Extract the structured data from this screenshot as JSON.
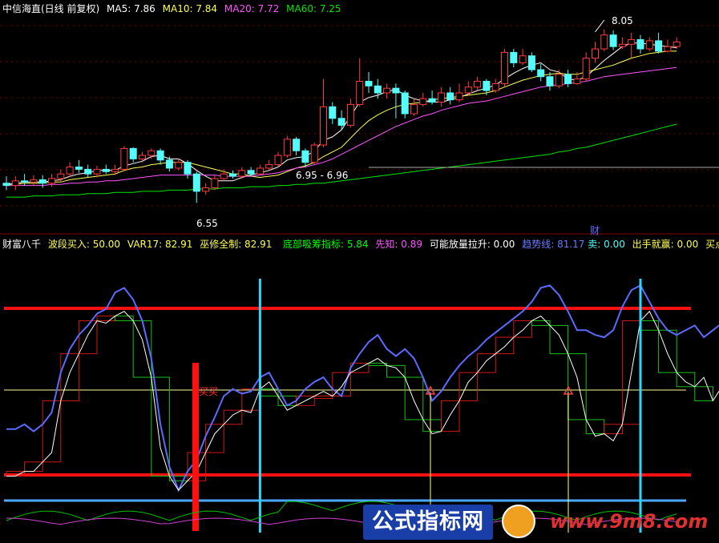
{
  "upper_header": {
    "title": "中信海直(日线 前复权)",
    "ma5": "MA5: 7.86",
    "ma10": "MA10: 7.84",
    "ma20": "MA20: 7.72",
    "ma60": "MA60: 7.25"
  },
  "lower_header": {
    "name": "财富八千",
    "bd": "波段买入: 50.00",
    "var17": "VAR17: 82.91",
    "wx": "巫修全制: 82.91",
    "dbxc": "底部吸筹指标: 5.84",
    "xz": "先知: 0.89",
    "knflls": "可能放量拉升: 0.00",
    "qsx": "趋势线: 81.17",
    "mai": "卖: 0.00",
    "cs": "出手就赢: 0.00",
    "mdzb": "买点准备:"
  },
  "annotations": {
    "high": "8.05",
    "low": "6.55",
    "range": "6.95 - 6.96",
    "cai": "财",
    "buy": "买买"
  },
  "watermark": {
    "text": "公式指标网",
    "url": "www.9m8.com"
  },
  "colors": {
    "up": "#ff3c3c",
    "down": "#54fcfc",
    "ma5": "#ffffff",
    "ma10": "#ffff54",
    "ma20": "#ff54ff",
    "ma60": "#00e600",
    "lower_line1": "#5b6bff",
    "lower_line2": "#ffffff",
    "cyan": "#28d8ff",
    "red": "#ff1010"
  },
  "chart_data": [
    {
      "type": "candlestick",
      "title": "中信海直(日线 前复权)",
      "ylim": [
        6.4,
        8.15
      ],
      "series": [
        {
          "name": "K",
          "values": [
            [
              6.72,
              6.7,
              6.78,
              6.66
            ],
            [
              6.7,
              6.74,
              6.78,
              6.66
            ],
            [
              6.74,
              6.73,
              6.8,
              6.7
            ],
            [
              6.73,
              6.75,
              6.79,
              6.7
            ],
            [
              6.75,
              6.72,
              6.79,
              6.68
            ],
            [
              6.72,
              6.76,
              6.8,
              6.69
            ],
            [
              6.76,
              6.8,
              6.84,
              6.73
            ],
            [
              6.8,
              6.86,
              6.9,
              6.77
            ],
            [
              6.86,
              6.84,
              6.92,
              6.81
            ],
            [
              6.84,
              6.8,
              6.88,
              6.77
            ],
            [
              6.8,
              6.84,
              6.87,
              6.77
            ],
            [
              6.84,
              6.82,
              6.88,
              6.8
            ],
            [
              6.82,
              6.84,
              6.88,
              6.79
            ],
            [
              6.84,
              7.02,
              7.04,
              6.82
            ],
            [
              7.02,
              6.93,
              7.03,
              6.9
            ],
            [
              6.93,
              6.96,
              6.99,
              6.9
            ],
            [
              6.96,
              7.0,
              7.02,
              6.93
            ],
            [
              7.0,
              6.92,
              7.02,
              6.88
            ],
            [
              6.92,
              6.85,
              6.95,
              6.82
            ],
            [
              6.85,
              6.9,
              6.93,
              6.83
            ],
            [
              6.9,
              6.8,
              6.92,
              6.76
            ],
            [
              6.8,
              6.65,
              6.82,
              6.55
            ],
            [
              6.65,
              6.68,
              6.72,
              6.62
            ],
            [
              6.68,
              6.76,
              6.79,
              6.66
            ],
            [
              6.76,
              6.8,
              6.84,
              6.74
            ],
            [
              6.8,
              6.78,
              6.83,
              6.76
            ],
            [
              6.78,
              6.83,
              6.86,
              6.76
            ],
            [
              6.83,
              6.8,
              6.86,
              6.78
            ],
            [
              6.8,
              6.85,
              6.88,
              6.79
            ],
            [
              6.85,
              6.88,
              6.92,
              6.83
            ],
            [
              6.88,
              6.96,
              6.99,
              6.86
            ],
            [
              6.96,
              7.1,
              7.13,
              6.94
            ],
            [
              7.1,
              7.0,
              7.12,
              6.96
            ],
            [
              7.0,
              6.9,
              7.02,
              6.86
            ],
            [
              6.9,
              7.05,
              7.07,
              6.88
            ],
            [
              7.05,
              7.38,
              7.62,
              7.03
            ],
            [
              7.38,
              7.28,
              7.42,
              7.23
            ],
            [
              7.28,
              7.22,
              7.35,
              7.18
            ],
            [
              7.22,
              7.4,
              7.45,
              7.2
            ],
            [
              7.4,
              7.6,
              7.8,
              7.38
            ],
            [
              7.6,
              7.56,
              7.68,
              7.5
            ],
            [
              7.56,
              7.5,
              7.62,
              7.45
            ],
            [
              7.5,
              7.54,
              7.58,
              7.45
            ],
            [
              7.54,
              7.5,
              7.58,
              7.28
            ],
            [
              7.5,
              7.32,
              7.52,
              7.28
            ],
            [
              7.32,
              7.4,
              7.45,
              7.3
            ],
            [
              7.4,
              7.45,
              7.5,
              7.38
            ],
            [
              7.45,
              7.42,
              7.52,
              7.4
            ],
            [
              7.42,
              7.5,
              7.55,
              7.38
            ],
            [
              7.5,
              7.44,
              7.55,
              7.4
            ],
            [
              7.44,
              7.5,
              7.58,
              7.42
            ],
            [
              7.5,
              7.55,
              7.6,
              7.48
            ],
            [
              7.55,
              7.6,
              7.64,
              7.52
            ],
            [
              7.6,
              7.52,
              7.62,
              7.48
            ],
            [
              7.52,
              7.58,
              7.62,
              7.5
            ],
            [
              7.58,
              7.85,
              7.88,
              7.55
            ],
            [
              7.85,
              7.76,
              7.88,
              7.72
            ],
            [
              7.76,
              7.82,
              7.88,
              7.74
            ],
            [
              7.82,
              7.7,
              7.85,
              7.68
            ],
            [
              7.7,
              7.64,
              7.75,
              7.6
            ],
            [
              7.64,
              7.56,
              7.68,
              7.52
            ],
            [
              7.56,
              7.66,
              7.7,
              7.54
            ],
            [
              7.66,
              7.58,
              7.7,
              7.55
            ],
            [
              7.58,
              7.62,
              7.68,
              7.57
            ],
            [
              7.62,
              7.8,
              7.85,
              7.6
            ],
            [
              7.8,
              7.88,
              7.94,
              7.76
            ],
            [
              7.88,
              8.0,
              8.05,
              7.86
            ],
            [
              8.0,
              7.9,
              8.04,
              7.87
            ],
            [
              7.9,
              7.92,
              7.98,
              7.88
            ],
            [
              7.92,
              7.96,
              8.02,
              7.8
            ],
            [
              7.96,
              7.88,
              8.0,
              7.84
            ],
            [
              7.88,
              7.95,
              7.98,
              7.86
            ],
            [
              7.95,
              7.86,
              8.02,
              7.84
            ],
            [
              7.86,
              7.9,
              7.96,
              7.85
            ],
            [
              7.9,
              7.94,
              7.98,
              7.88
            ]
          ]
        },
        {
          "name": "MA5",
          "values": [
            6.71,
            6.72,
            6.73,
            6.73,
            6.73,
            6.74,
            6.75,
            6.78,
            6.8,
            6.81,
            6.83,
            6.83,
            6.83,
            6.87,
            6.89,
            6.91,
            6.95,
            6.96,
            6.93,
            6.93,
            6.89,
            6.83,
            6.78,
            6.74,
            6.74,
            6.74,
            6.77,
            6.79,
            6.81,
            6.83,
            6.86,
            6.92,
            6.94,
            6.95,
            7.0,
            7.09,
            7.12,
            7.18,
            7.3,
            7.42,
            7.46,
            7.48,
            7.51,
            7.53,
            7.48,
            7.45,
            7.43,
            7.42,
            7.42,
            7.44,
            7.46,
            7.49,
            7.52,
            7.54,
            7.57,
            7.62,
            7.67,
            7.71,
            7.74,
            7.76,
            7.7,
            7.68,
            7.62,
            7.61,
            7.64,
            7.71,
            7.78,
            7.84,
            7.9,
            7.93,
            7.93,
            7.92,
            7.91,
            7.9,
            7.89
          ]
        },
        {
          "name": "MA10",
          "values": [
            6.71,
            6.71,
            6.72,
            6.72,
            6.72,
            6.73,
            6.73,
            6.75,
            6.76,
            6.77,
            6.78,
            6.79,
            6.8,
            6.83,
            6.85,
            6.86,
            6.88,
            6.89,
            6.9,
            6.9,
            6.9,
            6.88,
            6.86,
            6.84,
            6.82,
            6.8,
            6.8,
            6.78,
            6.77,
            6.78,
            6.79,
            6.82,
            6.85,
            6.87,
            6.9,
            6.95,
            6.99,
            7.03,
            7.11,
            7.19,
            7.26,
            7.31,
            7.35,
            7.38,
            7.4,
            7.41,
            7.42,
            7.44,
            7.45,
            7.46,
            7.47,
            7.48,
            7.49,
            7.5,
            7.52,
            7.55,
            7.58,
            7.61,
            7.63,
            7.65,
            7.66,
            7.67,
            7.66,
            7.66,
            7.68,
            7.7,
            7.72,
            7.74,
            7.77,
            7.8,
            7.82,
            7.84,
            7.85,
            7.86,
            7.86
          ]
        },
        {
          "name": "MA20",
          "values": [
            6.7,
            6.7,
            6.7,
            6.7,
            6.7,
            6.71,
            6.71,
            6.72,
            6.72,
            6.73,
            6.73,
            6.74,
            6.74,
            6.75,
            6.76,
            6.77,
            6.78,
            6.79,
            6.79,
            6.79,
            6.79,
            6.79,
            6.79,
            6.79,
            6.78,
            6.78,
            6.78,
            6.78,
            6.79,
            6.8,
            6.81,
            6.83,
            6.85,
            6.86,
            6.88,
            6.9,
            6.93,
            6.97,
            7.01,
            7.05,
            7.09,
            7.13,
            7.17,
            7.21,
            7.24,
            7.27,
            7.3,
            7.32,
            7.35,
            7.37,
            7.39,
            7.41,
            7.42,
            7.43,
            7.45,
            7.47,
            7.49,
            7.51,
            7.53,
            7.55,
            7.56,
            7.57,
            7.58,
            7.59,
            7.6,
            7.62,
            7.64,
            7.65,
            7.66,
            7.67,
            7.68,
            7.69,
            7.7,
            7.71,
            7.72
          ]
        },
        {
          "name": "MA60",
          "values": [
            6.6,
            6.6,
            6.6,
            6.61,
            6.61,
            6.61,
            6.62,
            6.62,
            6.62,
            6.63,
            6.63,
            6.63,
            6.64,
            6.64,
            6.64,
            6.65,
            6.65,
            6.65,
            6.66,
            6.66,
            6.66,
            6.67,
            6.67,
            6.67,
            6.68,
            6.68,
            6.68,
            6.69,
            6.69,
            6.69,
            6.7,
            6.7,
            6.71,
            6.71,
            6.72,
            6.72,
            6.73,
            6.74,
            6.75,
            6.76,
            6.77,
            6.78,
            6.79,
            6.8,
            6.81,
            6.82,
            6.83,
            6.84,
            6.85,
            6.86,
            6.87,
            6.88,
            6.89,
            6.9,
            6.91,
            6.92,
            6.93,
            6.94,
            6.95,
            6.96,
            6.97,
            6.99,
            7.0,
            7.02,
            7.03,
            7.05,
            7.07,
            7.09,
            7.11,
            7.13,
            7.15,
            7.17,
            7.19,
            7.21,
            7.23
          ]
        }
      ]
    },
    {
      "type": "line",
      "title": "财富八千",
      "ylim": [
        -6,
        108
      ],
      "x_vertical_markers": [
        28,
        70,
        99,
        117,
        124
      ],
      "series": [
        {
          "name": "L1",
          "values": [
            38,
            38,
            40,
            37,
            40,
            45,
            62,
            72,
            78,
            82,
            87,
            89,
            96,
            98,
            93,
            84,
            68,
            40,
            22,
            12,
            20,
            25,
            35,
            43,
            52,
            55,
            53,
            54,
            60,
            62,
            55,
            48,
            50,
            55,
            58,
            60,
            55,
            52,
            64,
            70,
            75,
            78,
            72,
            69,
            72,
            68,
            60,
            50,
            54,
            60,
            65,
            69,
            72,
            76,
            79,
            82,
            85,
            88,
            92,
            98,
            99,
            95,
            88,
            80,
            80,
            78,
            77,
            80,
            90,
            97,
            99,
            92,
            85,
            80,
            78,
            80,
            82,
            77,
            80,
            83
          ]
        },
        {
          "name": "L2",
          "values": [
            18,
            18,
            20,
            20,
            24,
            28,
            50,
            62,
            70,
            78,
            84,
            83,
            86,
            88,
            84,
            76,
            60,
            30,
            18,
            12,
            16,
            20,
            28,
            36,
            40,
            44,
            46,
            45,
            55,
            58,
            52,
            46,
            48,
            50,
            52,
            54,
            52,
            56,
            62,
            64,
            66,
            68,
            65,
            64,
            60,
            50,
            42,
            36,
            37,
            44,
            50,
            58,
            62,
            67,
            70,
            73,
            77,
            80,
            84,
            86,
            82,
            78,
            70,
            60,
            42,
            35,
            36,
            33,
            40,
            62,
            84,
            88,
            80,
            70,
            62,
            58,
            56,
            60,
            50,
            56
          ]
        }
      ]
    }
  ]
}
